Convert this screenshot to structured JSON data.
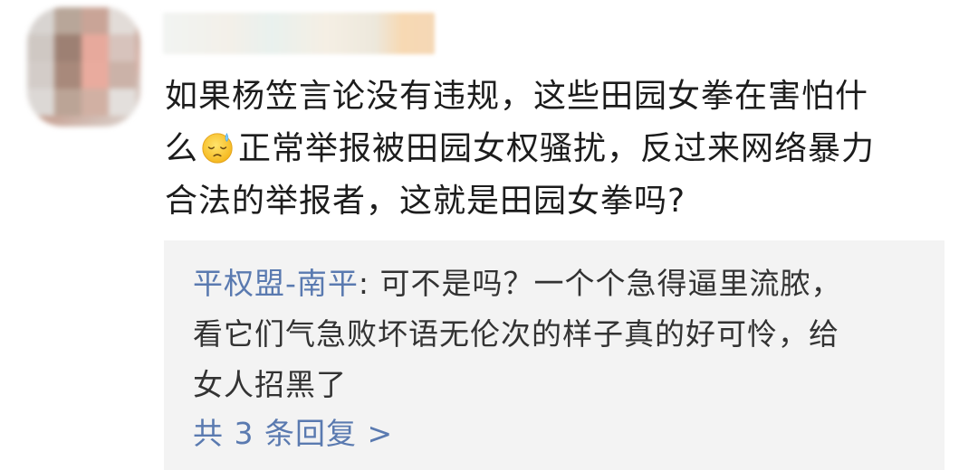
{
  "comment": {
    "line1": "如果杨笠言论没有违规，这些田园女拳在害怕什",
    "line2_pre": "么",
    "emoji_icon": "sweat-face-icon",
    "line2_post": "正常举报被田园女权骚扰，反过来网络暴力",
    "line3": "合法的举报者，这就是田园女拳吗?"
  },
  "reply": {
    "username": "平权盟-南平",
    "separator": ": ",
    "line1": "可不是吗？一个个急得逼里流脓，",
    "line2": "看它们气急败坏语无伦次的样子真的好可怜，给",
    "line3": "女人招黑了",
    "more_label": "共 3 条回复 >"
  },
  "colors": {
    "link_blue": "#5a7ab0",
    "reply_bg": "#f3f3f3",
    "text": "#1c1c1c"
  }
}
